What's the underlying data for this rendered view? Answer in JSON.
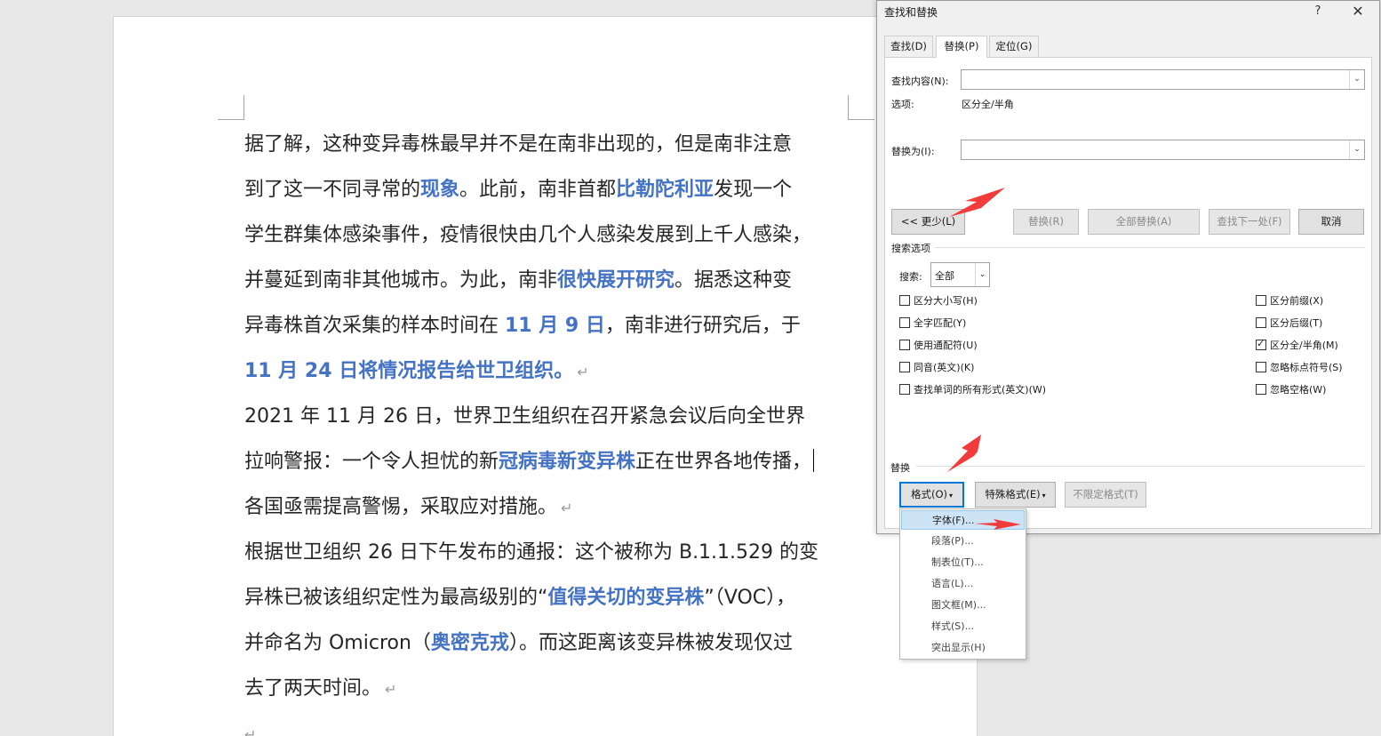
{
  "document": {
    "lines": [
      [
        {
          "t": "据了解，这种变异毒株最早并不是在南非出现的，但是南非注意"
        }
      ],
      [
        {
          "t": "到了这一不同寻常的"
        },
        {
          "t": "现象",
          "h": true
        },
        {
          "t": "。此前，南非首都"
        },
        {
          "t": "比勒陀利亚",
          "h": true
        },
        {
          "t": "发现一个"
        }
      ],
      [
        {
          "t": "学生群集体感染事件，疫情很快由几个人感染发展到上千人感染，"
        }
      ],
      [
        {
          "t": "并蔓延到南非其他城市。为此，南非"
        },
        {
          "t": "很快展开研究",
          "h": true
        },
        {
          "t": "。据悉这种变"
        }
      ],
      [
        {
          "t": "异毒株首次采集的样本时间在 "
        },
        {
          "t": "11 月 9 日",
          "h": true
        },
        {
          "t": "，南非进行研究后，于"
        }
      ],
      [
        {
          "t": "11 月 24 日将情况报告给世卫组织。",
          "h": true
        },
        {
          "pm": "↵"
        }
      ],
      [
        {
          "t": "2021 年 11 月 26 日，世界卫生组织在召开紧急会议后向全世界"
        }
      ],
      [
        {
          "t": "拉响警报：一个令人担忧的新"
        },
        {
          "t": "冠病毒新变异株",
          "h": true
        },
        {
          "t": "正在世界各地传播，"
        },
        {
          "cursor": true
        }
      ],
      [
        {
          "t": "各国亟需提高警惕，采取应对措施。"
        },
        {
          "pm": "↵"
        }
      ],
      [
        {
          "t": "根据世卫组织 26 日下午发布的通报：这个被称为 B.1.1.529 的变"
        }
      ],
      [
        {
          "t": "异株已被该组织定性为最高级别的“"
        },
        {
          "t": "值得关切的变异株",
          "h": true
        },
        {
          "t": "”（VOC），"
        }
      ],
      [
        {
          "t": "并命名为 Omicron（"
        },
        {
          "t": "奥密克戎",
          "h": true
        },
        {
          "t": "）。而这距离该变异株被发现仅过"
        }
      ],
      [
        {
          "t": "去了两天时间。"
        },
        {
          "pm": "↵"
        }
      ]
    ],
    "trailing_mark": "↵"
  },
  "dialog": {
    "title": "查找和替换",
    "help": "?",
    "close": "✕",
    "tabs": {
      "find": "查找(D)",
      "replace": "替换(P)",
      "goto": "定位(G)"
    },
    "find_label": "查找内容(N):",
    "find_value": "",
    "options_label": "选项:",
    "options_value": "区分全/半角",
    "replace_label": "替换为(I):",
    "replace_value": "",
    "buttons": {
      "less": "<< 更少(L)",
      "replace": "替换(R)",
      "replace_all": "全部替换(A)",
      "find_next": "查找下一处(F)",
      "cancel": "取消"
    },
    "search_options_header": "搜索选项",
    "search_label": "搜索:",
    "search_value": "全部",
    "checkboxes_left": [
      {
        "label": "区分大小写(H)",
        "checked": false
      },
      {
        "label": "全字匹配(Y)",
        "checked": false
      },
      {
        "label": "使用通配符(U)",
        "checked": false
      },
      {
        "label": "同音(英文)(K)",
        "checked": false
      },
      {
        "label": "查找单词的所有形式(英文)(W)",
        "checked": false
      }
    ],
    "checkboxes_right": [
      {
        "label": "区分前缀(X)",
        "checked": false
      },
      {
        "label": "区分后缀(T)",
        "checked": false
      },
      {
        "label": "区分全/半角(M)",
        "checked": true
      },
      {
        "label": "忽略标点符号(S)",
        "checked": false
      },
      {
        "label": "忽略空格(W)",
        "checked": false
      }
    ],
    "replace_header": "替换",
    "format_btn": "格式(O)",
    "special_btn": "特殊格式(E)",
    "no_format_btn": "不限定格式(T)",
    "caret": "▾",
    "combo_arrow": "⌄"
  },
  "format_menu": {
    "items": [
      "字体(F)...",
      "段落(P)...",
      "制表位(T)...",
      "语言(L)...",
      "图文框(M)...",
      "样式(S)...",
      "突出显示(H)"
    ],
    "active_index": 0
  },
  "colors": {
    "highlight_text": "#4472c4",
    "annotation_arrow": "#f23c3c",
    "focus_border": "#0078d7"
  }
}
